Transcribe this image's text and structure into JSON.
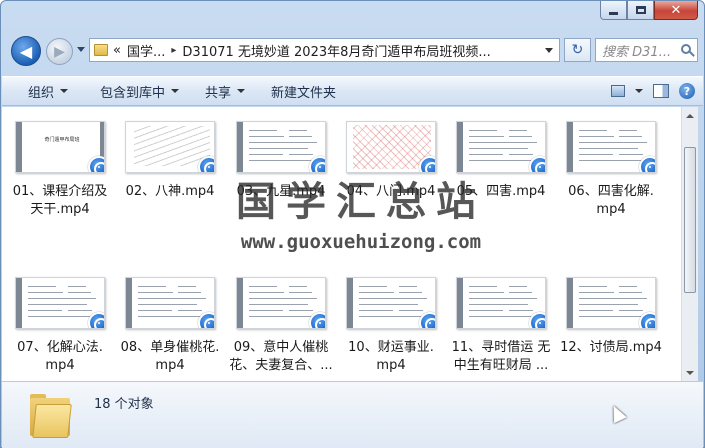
{
  "window": {
    "caption_buttons": {
      "close": "✕"
    }
  },
  "nav": {
    "back_glyph": "◀",
    "forward_glyph": "▶",
    "address": {
      "prefix": "«",
      "crumb1": "国学...",
      "sep": "▸",
      "crumb2": "D31071 无境妙道 2023年8月奇门遁甲布局班视频..."
    },
    "refresh_glyph": "↻",
    "search_placeholder": "搜索 D31..."
  },
  "toolbar": {
    "organize": "组织",
    "include_library": "包含到库中",
    "share": "共享",
    "new_folder": "新建文件夹",
    "help": "?"
  },
  "files": [
    {
      "name": "01、课程介绍及天干.mp4",
      "line1": "01、课程介绍及",
      "line2": "天干.mp4",
      "thumb": "title",
      "thumb_title": "奇门遁甲布局班"
    },
    {
      "name": "02、八神.mp4",
      "line1": "02、八神.mp4",
      "line2": "",
      "thumb": "hand"
    },
    {
      "name": "03、九星.mp4",
      "line1": "03、九星.mp4",
      "line2": "",
      "thumb": "text"
    },
    {
      "name": "04、八门.mp4",
      "line1": "04、八门.mp4",
      "line2": "",
      "thumb": "red"
    },
    {
      "name": "05、四害.mp4",
      "line1": "05、四害.mp4",
      "line2": "",
      "thumb": "text"
    },
    {
      "name": "06、四害化解.mp4",
      "line1": "06、四害化解.",
      "line2": "mp4",
      "thumb": "text"
    },
    {
      "name": "07、化解心法.mp4",
      "line1": "07、化解心法.",
      "line2": "mp4",
      "thumb": "text"
    },
    {
      "name": "08、单身催桃花.mp4",
      "line1": "08、单身催桃花.",
      "line2": "mp4",
      "thumb": "text"
    },
    {
      "name": "09、意中人催桃花、夫妻复合...",
      "line1": "09、意中人催桃",
      "line2": "花、夫妻复合、...",
      "thumb": "text"
    },
    {
      "name": "10、财运事业.mp4",
      "line1": "10、财运事业.",
      "line2": "mp4",
      "thumb": "text"
    },
    {
      "name": "11、寻时借运 无中生有旺财局...",
      "line1": "11、寻时借运 无",
      "line2": "中生有旺财局 ...",
      "thumb": "text"
    },
    {
      "name": "12、讨债局.mp4",
      "line1": "12、讨债局.mp4",
      "line2": "",
      "thumb": "text"
    }
  ],
  "watermark": {
    "title": "国学汇总站",
    "url": "www.guoxuehuizong.com"
  },
  "details": {
    "count": "18 个对象"
  },
  "colors": {
    "frame": "#b9d1ec",
    "media_badge": "#1763c9"
  }
}
